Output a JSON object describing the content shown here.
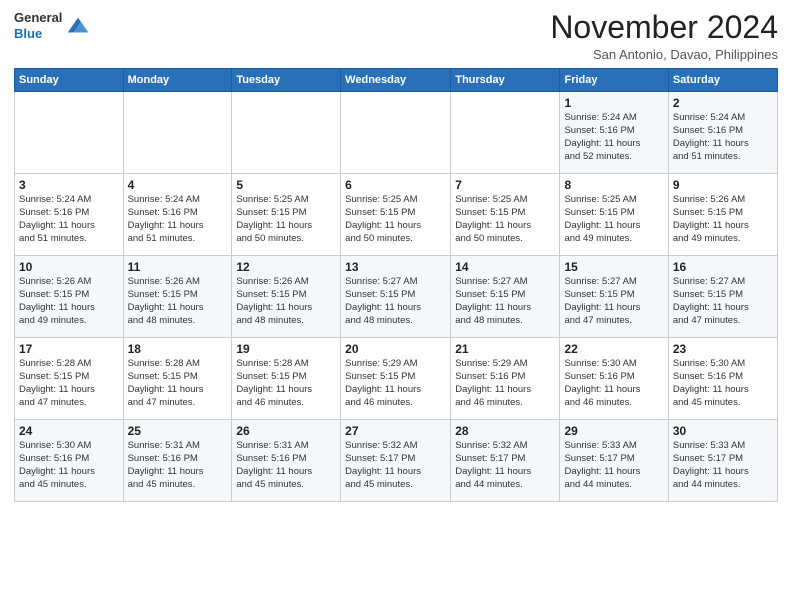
{
  "header": {
    "logo_general": "General",
    "logo_blue": "Blue",
    "month_title": "November 2024",
    "location": "San Antonio, Davao, Philippines"
  },
  "calendar": {
    "days_of_week": [
      "Sunday",
      "Monday",
      "Tuesday",
      "Wednesday",
      "Thursday",
      "Friday",
      "Saturday"
    ],
    "weeks": [
      [
        {
          "day": "",
          "info": ""
        },
        {
          "day": "",
          "info": ""
        },
        {
          "day": "",
          "info": ""
        },
        {
          "day": "",
          "info": ""
        },
        {
          "day": "",
          "info": ""
        },
        {
          "day": "1",
          "info": "Sunrise: 5:24 AM\nSunset: 5:16 PM\nDaylight: 11 hours\nand 52 minutes."
        },
        {
          "day": "2",
          "info": "Sunrise: 5:24 AM\nSunset: 5:16 PM\nDaylight: 11 hours\nand 51 minutes."
        }
      ],
      [
        {
          "day": "3",
          "info": "Sunrise: 5:24 AM\nSunset: 5:16 PM\nDaylight: 11 hours\nand 51 minutes."
        },
        {
          "day": "4",
          "info": "Sunrise: 5:24 AM\nSunset: 5:16 PM\nDaylight: 11 hours\nand 51 minutes."
        },
        {
          "day": "5",
          "info": "Sunrise: 5:25 AM\nSunset: 5:15 PM\nDaylight: 11 hours\nand 50 minutes."
        },
        {
          "day": "6",
          "info": "Sunrise: 5:25 AM\nSunset: 5:15 PM\nDaylight: 11 hours\nand 50 minutes."
        },
        {
          "day": "7",
          "info": "Sunrise: 5:25 AM\nSunset: 5:15 PM\nDaylight: 11 hours\nand 50 minutes."
        },
        {
          "day": "8",
          "info": "Sunrise: 5:25 AM\nSunset: 5:15 PM\nDaylight: 11 hours\nand 49 minutes."
        },
        {
          "day": "9",
          "info": "Sunrise: 5:26 AM\nSunset: 5:15 PM\nDaylight: 11 hours\nand 49 minutes."
        }
      ],
      [
        {
          "day": "10",
          "info": "Sunrise: 5:26 AM\nSunset: 5:15 PM\nDaylight: 11 hours\nand 49 minutes."
        },
        {
          "day": "11",
          "info": "Sunrise: 5:26 AM\nSunset: 5:15 PM\nDaylight: 11 hours\nand 48 minutes."
        },
        {
          "day": "12",
          "info": "Sunrise: 5:26 AM\nSunset: 5:15 PM\nDaylight: 11 hours\nand 48 minutes."
        },
        {
          "day": "13",
          "info": "Sunrise: 5:27 AM\nSunset: 5:15 PM\nDaylight: 11 hours\nand 48 minutes."
        },
        {
          "day": "14",
          "info": "Sunrise: 5:27 AM\nSunset: 5:15 PM\nDaylight: 11 hours\nand 48 minutes."
        },
        {
          "day": "15",
          "info": "Sunrise: 5:27 AM\nSunset: 5:15 PM\nDaylight: 11 hours\nand 47 minutes."
        },
        {
          "day": "16",
          "info": "Sunrise: 5:27 AM\nSunset: 5:15 PM\nDaylight: 11 hours\nand 47 minutes."
        }
      ],
      [
        {
          "day": "17",
          "info": "Sunrise: 5:28 AM\nSunset: 5:15 PM\nDaylight: 11 hours\nand 47 minutes."
        },
        {
          "day": "18",
          "info": "Sunrise: 5:28 AM\nSunset: 5:15 PM\nDaylight: 11 hours\nand 47 minutes."
        },
        {
          "day": "19",
          "info": "Sunrise: 5:28 AM\nSunset: 5:15 PM\nDaylight: 11 hours\nand 46 minutes."
        },
        {
          "day": "20",
          "info": "Sunrise: 5:29 AM\nSunset: 5:15 PM\nDaylight: 11 hours\nand 46 minutes."
        },
        {
          "day": "21",
          "info": "Sunrise: 5:29 AM\nSunset: 5:16 PM\nDaylight: 11 hours\nand 46 minutes."
        },
        {
          "day": "22",
          "info": "Sunrise: 5:30 AM\nSunset: 5:16 PM\nDaylight: 11 hours\nand 46 minutes."
        },
        {
          "day": "23",
          "info": "Sunrise: 5:30 AM\nSunset: 5:16 PM\nDaylight: 11 hours\nand 45 minutes."
        }
      ],
      [
        {
          "day": "24",
          "info": "Sunrise: 5:30 AM\nSunset: 5:16 PM\nDaylight: 11 hours\nand 45 minutes."
        },
        {
          "day": "25",
          "info": "Sunrise: 5:31 AM\nSunset: 5:16 PM\nDaylight: 11 hours\nand 45 minutes."
        },
        {
          "day": "26",
          "info": "Sunrise: 5:31 AM\nSunset: 5:16 PM\nDaylight: 11 hours\nand 45 minutes."
        },
        {
          "day": "27",
          "info": "Sunrise: 5:32 AM\nSunset: 5:17 PM\nDaylight: 11 hours\nand 45 minutes."
        },
        {
          "day": "28",
          "info": "Sunrise: 5:32 AM\nSunset: 5:17 PM\nDaylight: 11 hours\nand 44 minutes."
        },
        {
          "day": "29",
          "info": "Sunrise: 5:33 AM\nSunset: 5:17 PM\nDaylight: 11 hours\nand 44 minutes."
        },
        {
          "day": "30",
          "info": "Sunrise: 5:33 AM\nSunset: 5:17 PM\nDaylight: 11 hours\nand 44 minutes."
        }
      ]
    ]
  }
}
